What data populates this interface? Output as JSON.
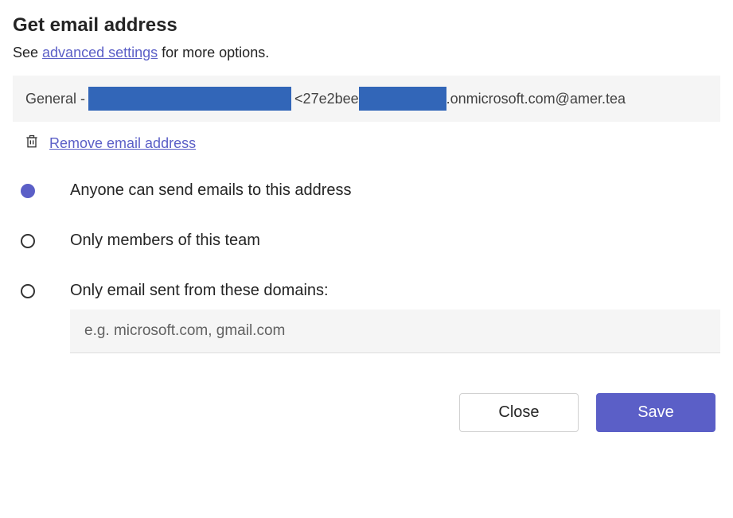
{
  "dialog": {
    "title": "Get email address",
    "subtitle_prefix": "See ",
    "subtitle_link": "advanced settings",
    "subtitle_suffix": " for more options."
  },
  "email": {
    "prefix": "General - ",
    "mid": " <27e2bee",
    "suffix": ".onmicrosoft.com@amer.tea"
  },
  "remove": {
    "label": "Remove email address"
  },
  "options": {
    "anyone": {
      "label": "Anyone can send emails to this address",
      "selected": true
    },
    "members": {
      "label": "Only members of this team",
      "selected": false
    },
    "domains": {
      "label": "Only email sent from these domains:",
      "selected": false
    }
  },
  "domain_input": {
    "placeholder": "e.g. microsoft.com, gmail.com",
    "value": ""
  },
  "buttons": {
    "close": "Close",
    "save": "Save"
  }
}
